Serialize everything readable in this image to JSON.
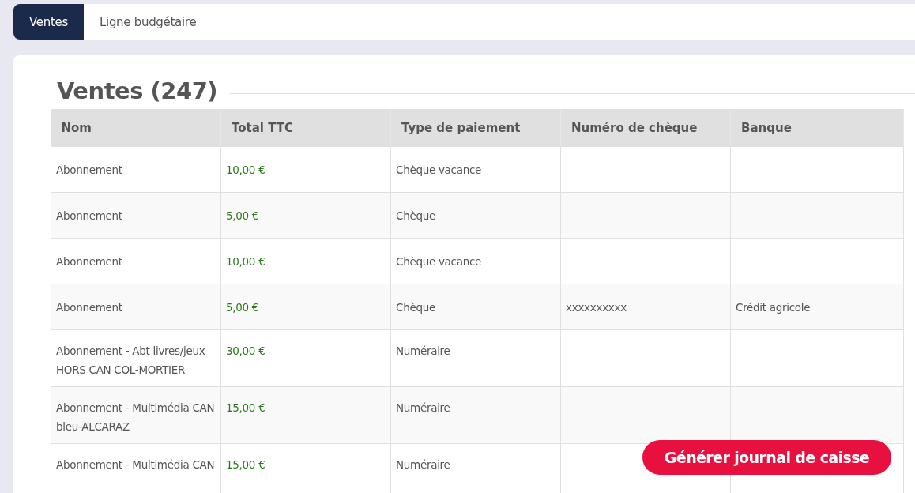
{
  "tabs": [
    {
      "label": "Ventes",
      "selected": true
    },
    {
      "label": "Ligne budgétaire",
      "selected": false
    }
  ],
  "section": {
    "title": "Ventes (247)"
  },
  "table": {
    "columns": [
      "Nom",
      "Total TTC",
      "Type de paiement",
      "Numéro de chèque",
      "Banque"
    ],
    "rows": [
      {
        "nom": "Abonnement",
        "total": "10,00 €",
        "paiement": "Chèque vacance"
      },
      {
        "nom": "Abonnement",
        "total": "5,00 €",
        "paiement": "Chèque"
      },
      {
        "nom": "Abonnement",
        "total": "10,00 €",
        "paiement": "Chèque vacance"
      },
      {
        "nom": "Abonnement",
        "total": "5,00 €",
        "paiement": "Chèque",
        "cheque": "xxxxxxxxxx",
        "banque": "Crédit agricole"
      },
      {
        "nom": "Abonnement - Abt livres/jeux HORS CAN COL-MORTIER",
        "total": "30,00 €",
        "paiement": "Numéraire"
      },
      {
        "nom": "Abonnement - Multimédia CAN bleu-ALCARAZ",
        "total": "15,00 €",
        "paiement": "Numéraire"
      },
      {
        "nom": "Abonnement - Multimédia CAN",
        "total": "15,00 €",
        "paiement": "Numéraire"
      }
    ]
  },
  "action_button": {
    "label": "Générer journal de caisse"
  }
}
